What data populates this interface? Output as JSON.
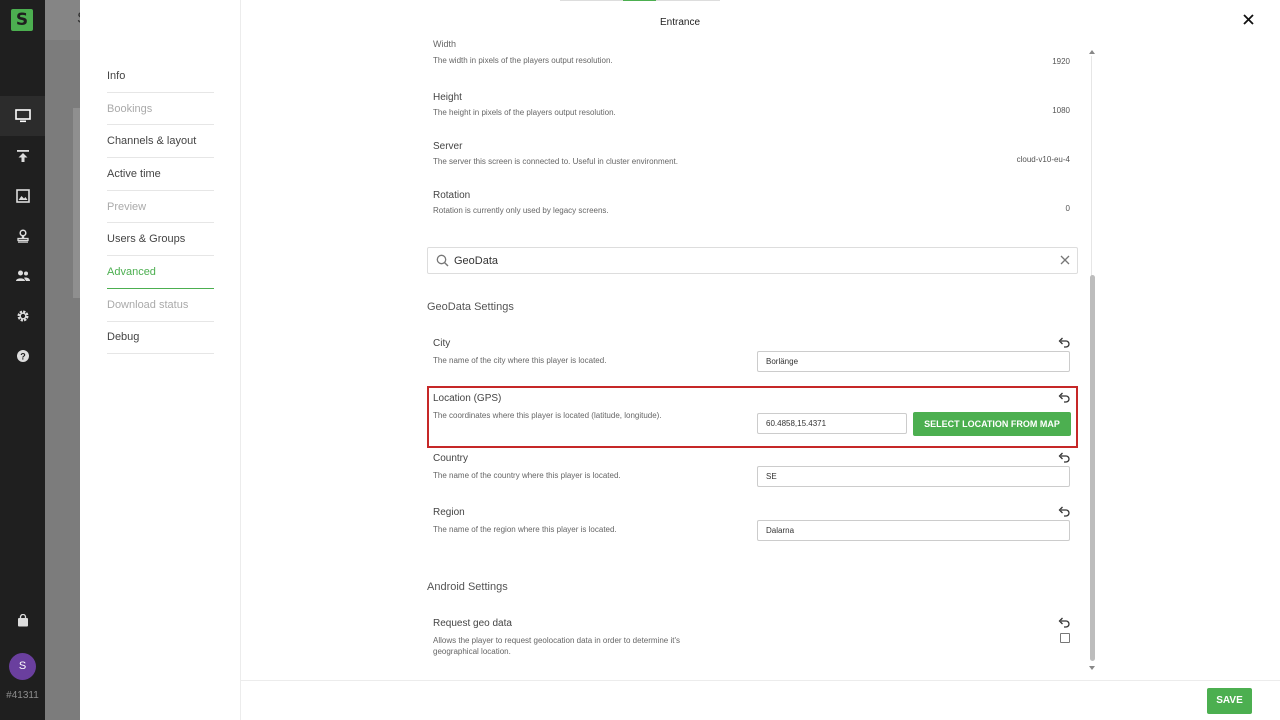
{
  "rail": {
    "logo": "S",
    "icons": [
      "display-icon",
      "upload-icon",
      "image-icon",
      "stamp-icon",
      "people-icon",
      "gear-icon",
      "help-icon"
    ],
    "bag_icon": "shopping-bag-icon",
    "avatar_letter": "S",
    "account_id": "#41311"
  },
  "background_app": {
    "title_letter": "S"
  },
  "modal": {
    "title": "Entrance",
    "close_icon": "close-icon"
  },
  "sidenav": [
    {
      "label": "Info",
      "state": "normal"
    },
    {
      "label": "Bookings",
      "state": "disabled"
    },
    {
      "label": "Channels & layout",
      "state": "normal"
    },
    {
      "label": "Active time",
      "state": "normal"
    },
    {
      "label": "Preview",
      "state": "disabled"
    },
    {
      "label": "Users & Groups",
      "state": "normal"
    },
    {
      "label": "Advanced",
      "state": "active"
    },
    {
      "label": "Download status",
      "state": "disabled"
    },
    {
      "label": "Debug",
      "state": "normal"
    }
  ],
  "properties": {
    "clipped_title": "Width",
    "rows": [
      {
        "title": "",
        "desc": "The width in pixels of the players output resolution.",
        "value": "1920"
      },
      {
        "title": "Height",
        "desc": "The height in pixels of the players output resolution.",
        "value": "1080"
      },
      {
        "title": "Server",
        "desc": "The server this screen is connected to. Useful in cluster environment.",
        "value": "cloud-v10-eu-4"
      },
      {
        "title": "Rotation",
        "desc": "Rotation is currently only used by legacy screens.",
        "value": "0"
      }
    ]
  },
  "search": {
    "query": "GeoData"
  },
  "geodata": {
    "section_title": "GeoData Settings",
    "city": {
      "title": "City",
      "desc": "The name of the city where this player is located.",
      "value": "Borlänge"
    },
    "location": {
      "title": "Location (GPS)",
      "desc": "The coordinates where this player is located (latitude, longitude).",
      "value": "60.4858,15.4371",
      "button": "SELECT LOCATION FROM MAP"
    },
    "country": {
      "title": "Country",
      "desc": "The name of the country where this player is located.",
      "value": "SE"
    },
    "region": {
      "title": "Region",
      "desc": "The name of the region where this player is located.",
      "value": "Dalarna"
    }
  },
  "android": {
    "section_title": "Android Settings",
    "request_geo": {
      "title": "Request geo data",
      "desc_line1": "Allows the player to request geolocation data in order to determine it's",
      "desc_line2": "geographical location.",
      "checked": false
    }
  },
  "footer": {
    "save_label": "SAVE"
  },
  "colors": {
    "accent": "#4caf50",
    "highlight": "#c62828",
    "rail": "#1f1f1f",
    "avatar": "#6a3f9e"
  }
}
